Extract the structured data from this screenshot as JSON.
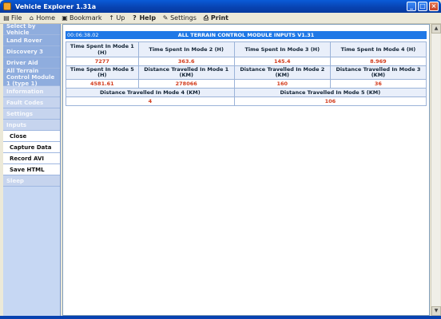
{
  "window": {
    "title": "Vehicle Explorer 1.31a"
  },
  "menu": [
    {
      "label": "File",
      "icon": "folder-icon",
      "bold": false
    },
    {
      "label": "Home",
      "icon": "home-icon",
      "bold": false
    },
    {
      "label": "Bookmark",
      "icon": "bookmark-icon",
      "bold": false
    },
    {
      "label": "Up",
      "icon": "up-icon",
      "bold": false
    },
    {
      "label": "Help",
      "icon": "help-icon",
      "bold": true
    },
    {
      "label": "Settings",
      "icon": "settings-icon",
      "bold": false
    },
    {
      "label": "Print",
      "icon": "print-icon",
      "bold": true
    }
  ],
  "sidebar": {
    "items": [
      {
        "label": "Select by Vehicle",
        "style": "blue"
      },
      {
        "label": "Land Rover",
        "style": "blue"
      },
      {
        "label": "Discovery 3",
        "style": "blue"
      },
      {
        "label": "Driver Aid",
        "style": "blue"
      },
      {
        "label": "All Terrain Control Module 1 (type 1)",
        "style": "blue-double"
      },
      {
        "label": "Information",
        "style": "grey"
      },
      {
        "label": "Fault Codes",
        "style": "grey"
      },
      {
        "label": "Settings",
        "style": "grey"
      },
      {
        "label": "Inputs",
        "style": "grey"
      },
      {
        "label": "Close",
        "style": "action"
      },
      {
        "label": "Capture Data",
        "style": "action"
      },
      {
        "label": "Record AVI",
        "style": "action"
      },
      {
        "label": "Save HTML",
        "style": "action"
      },
      {
        "label": "Sleep",
        "style": "grey"
      }
    ]
  },
  "content": {
    "timestamp": "00:06:38.02",
    "title": "ALL TERRAIN CONTROL MODULE INPUTS V1.31",
    "row1": {
      "labels": [
        "Time Spent In Mode 1 (H)",
        "Time Spent In Mode 2 (H)",
        "Time Spent In Mode 3 (H)",
        "Time Spent In Mode 4 (H)"
      ],
      "values": [
        "7277",
        "363.6",
        "145.4",
        "8.969"
      ]
    },
    "row2": {
      "labels": [
        "Time Spent In Mode 5 (H)",
        "Distance Travelled In Mode 1 (KM)",
        "Distance Travelled In Mode 2 (KM)",
        "Distance Travelled In Mode 3 (KM)"
      ],
      "values": [
        "4581.61",
        "278066",
        "160",
        "36"
      ]
    },
    "row3": {
      "labels": [
        "Distance Travelled In Mode 4 (KM)",
        "Distance Travelled In Mode 5 (KM)"
      ],
      "values": [
        "4",
        "106"
      ]
    }
  },
  "colors": {
    "header": "#1f78e6",
    "value": "#d23b1c",
    "sidebar_blue": "#8fadde"
  }
}
